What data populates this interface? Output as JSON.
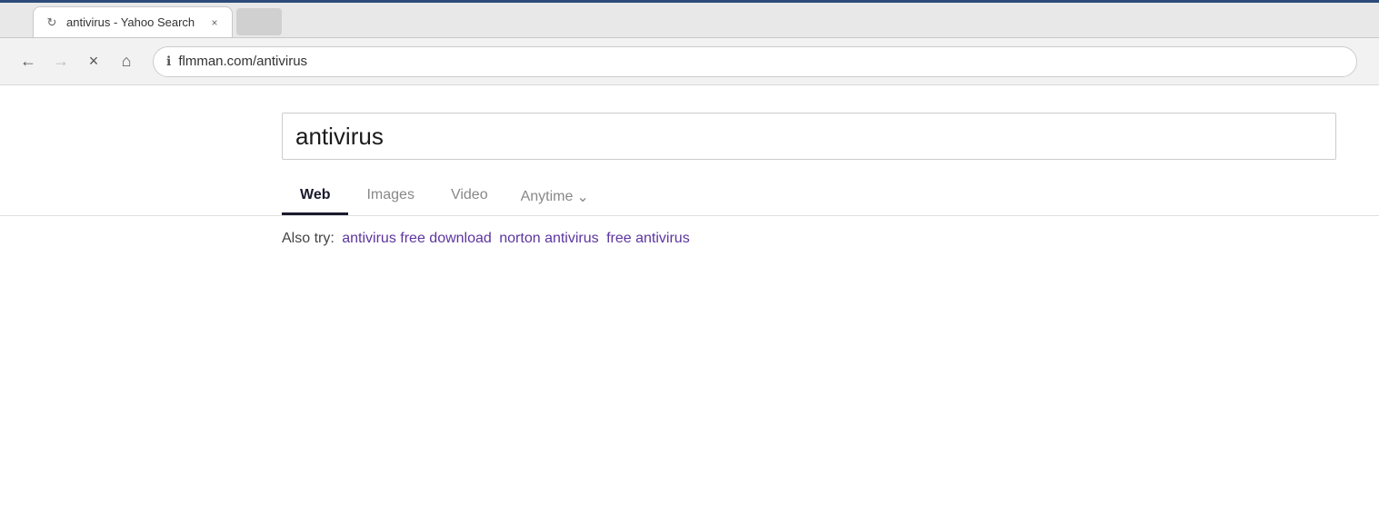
{
  "browser": {
    "accent_color": "#2d4a7a",
    "tab": {
      "title": "antivirus - Yahoo Search",
      "favicon": "↻",
      "close_label": "×"
    },
    "new_tab_placeholder": "",
    "nav": {
      "back_label": "←",
      "forward_label": "→",
      "close_label": "×",
      "home_label": "⌂"
    },
    "address_bar": {
      "info_icon": "ℹ",
      "url": "flmman.com/antivirus"
    }
  },
  "page": {
    "search_query": "antivirus",
    "filters": [
      {
        "label": "Web",
        "active": true
      },
      {
        "label": "Images",
        "active": false
      },
      {
        "label": "Video",
        "active": false
      },
      {
        "label": "Anytime",
        "active": false,
        "dropdown": true
      }
    ],
    "also_try": {
      "prefix": "Also try:",
      "links": [
        "antivirus free download",
        "norton antivirus",
        "free antivirus"
      ]
    }
  }
}
